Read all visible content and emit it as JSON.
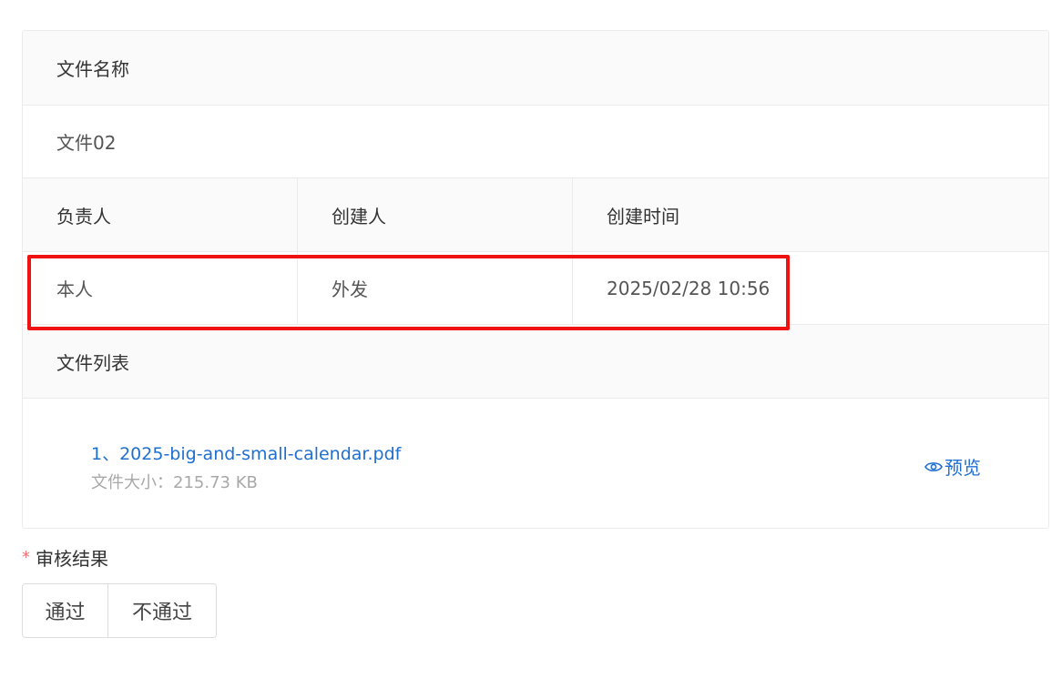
{
  "info": {
    "file_name_label": "文件名称",
    "file_name_value": "文件02",
    "owner_label": "负责人",
    "creator_label": "创建人",
    "created_time_label": "创建时间",
    "owner_value": "本人",
    "creator_value": "外发",
    "created_time_value": "2025/02/28 10:56",
    "file_list_label": "文件列表"
  },
  "files": [
    {
      "name": "1、2025-big-and-small-calendar.pdf",
      "size_text": "文件大小：215.73 KB",
      "preview_label": "预览",
      "preview_icon": "eye-icon"
    }
  ],
  "review": {
    "required_mark": "*",
    "label": "审核结果",
    "options": [
      "通过",
      "不通过"
    ]
  },
  "colors": {
    "link": "#1f6fd1",
    "highlight": "#f01111",
    "required": "#f56c6c",
    "header_bg": "#fafafa",
    "border": "#ebebeb"
  }
}
